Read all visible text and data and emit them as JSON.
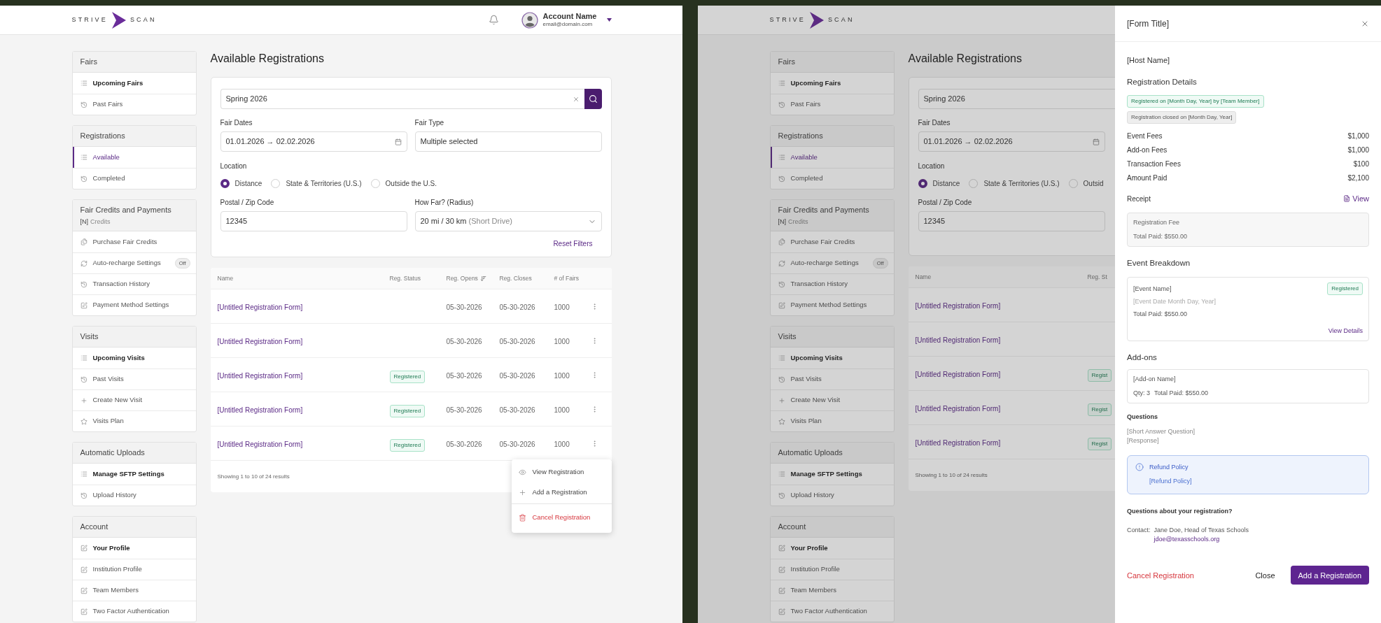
{
  "screens": [
    {
      "header": {
        "logo": {
          "left": "STRIVE",
          "right": "SCAN"
        },
        "account": {
          "name": "Account Name",
          "email": "email@domain.com"
        }
      },
      "sidebar": [
        {
          "title": "Fairs",
          "items": [
            {
              "label": "Upcoming Fairs",
              "kind": "list",
              "selected": false,
              "bold": true
            },
            {
              "label": "Past Fairs",
              "kind": "history",
              "selected": false,
              "bold": false
            }
          ]
        },
        {
          "title": "Registrations",
          "items": [
            {
              "label": "Available",
              "kind": "list",
              "selected": true
            },
            {
              "label": "Completed",
              "kind": "history",
              "selected": false,
              "bold": false
            }
          ]
        },
        {
          "title": "Fair Credits and Payments",
          "count": "[N]",
          "count_label": "Credits",
          "items": [
            {
              "label": "Purchase Fair Credits",
              "kind": "credits",
              "selected": false,
              "bold": false
            },
            {
              "label": "Auto-recharge Settings",
              "kind": "recharge",
              "selected": false,
              "bold": false,
              "badge": "Off"
            },
            {
              "label": "Transaction History",
              "kind": "history",
              "selected": false,
              "bold": false
            },
            {
              "label": "Payment Method Settings",
              "kind": "edit",
              "selected": false,
              "bold": false
            }
          ]
        },
        {
          "title": "Visits",
          "items": [
            {
              "label": "Upcoming Visits",
              "kind": "list",
              "selected": false,
              "bold": true
            },
            {
              "label": "Past Visits",
              "kind": "history",
              "selected": false,
              "bold": false
            },
            {
              "label": "Create New Visit",
              "kind": "plus",
              "selected": false,
              "bold": false
            },
            {
              "label": "Visits Plan",
              "kind": "star",
              "selected": false,
              "bold": false
            }
          ]
        },
        {
          "title": "Automatic Uploads",
          "items": [
            {
              "label": "Manage SFTP Settings",
              "kind": "list",
              "selected": false,
              "bold": true
            },
            {
              "label": "Upload History",
              "kind": "history",
              "selected": false,
              "bold": false
            }
          ]
        },
        {
          "title": "Account",
          "items": [
            {
              "label": "Your Profile",
              "kind": "edit",
              "selected": false,
              "bold": true
            },
            {
              "label": "Institution Profile",
              "kind": "edit",
              "selected": false,
              "bold": false
            },
            {
              "label": "Team Members",
              "kind": "edit",
              "selected": false,
              "bold": false
            },
            {
              "label": "Two Factor Authentication",
              "kind": "edit",
              "selected": false,
              "bold": false
            }
          ]
        }
      ],
      "main": {
        "title": "Available Registrations",
        "filters": {
          "search": {
            "value": "Spring 2026",
            "clear_button": true,
            "search_button": true
          },
          "fair_dates": {
            "label": "Fair Dates",
            "start": "01.01.2026",
            "separator": "→",
            "end": "02.02.2026"
          },
          "fair_type": {
            "label": "Fair Type",
            "value": "Multiple selected"
          },
          "location": {
            "label": "Location",
            "options": [
              {
                "label": "Distance",
                "selected": true
              },
              {
                "label": "State & Territories (U.S.)",
                "selected": false
              },
              {
                "label": "Outside the U.S.",
                "selected": false
              }
            ]
          },
          "postal": {
            "label": "Postal / Zip Code",
            "value": "12345"
          },
          "radius": {
            "label": "How Far? (Radius)",
            "value": "20 mi / 30 km",
            "hint": "(Short Drive)"
          },
          "reset": "Reset Filters"
        },
        "table": {
          "columns": [
            {
              "label": "Name",
              "sorted": false
            },
            {
              "label": "Reg. Status",
              "sorted": false
            },
            {
              "label": "Reg. Opens",
              "sorted": true
            },
            {
              "label": "Reg. Closes",
              "sorted": false
            },
            {
              "label": "# of Fairs",
              "sorted": false
            }
          ],
          "row_actions": true,
          "rows": [
            {
              "name": "[Untitled Registration Form]",
              "opens": "05-30-2026",
              "closes": "05-30-2026",
              "fairs": "1000"
            },
            {
              "name": "[Untitled Registration Form]",
              "opens": "05-30-2026",
              "closes": "05-30-2026",
              "fairs": "1000"
            },
            {
              "name": "[Untitled Registration Form]",
              "status": "Registered",
              "opens": "05-30-2026",
              "closes": "05-30-2026",
              "fairs": "1000"
            },
            {
              "name": "[Untitled Registration Form]",
              "status": "Registered",
              "opens": "05-30-2026",
              "closes": "05-30-2026",
              "fairs": "1000"
            },
            {
              "name": "[Untitled Registration Form]",
              "status": "Registered",
              "opens": "05-30-2026",
              "closes": "05-30-2026",
              "fairs": "1000"
            }
          ],
          "footer": "Showing 1 to 10 of 24 results",
          "menu": [
            {
              "label": "View Registration",
              "kind": "view"
            },
            {
              "label": "Add a Registration",
              "kind": "add"
            },
            {
              "label": "Cancel Registration",
              "kind": "danger"
            }
          ]
        }
      }
    },
    {
      "dimmed": true,
      "header": {
        "logo": {
          "left": "STRIVE",
          "right": "SCAN"
        }
      },
      "sidebar": [
        {
          "title": "Fairs",
          "items": [
            {
              "label": "Upcoming Fairs",
              "kind": "list",
              "selected": false,
              "bold": true
            },
            {
              "label": "Past Fairs",
              "kind": "history",
              "selected": false,
              "bold": false
            }
          ]
        },
        {
          "title": "Registrations",
          "items": [
            {
              "label": "Available",
              "kind": "list",
              "selected": true
            },
            {
              "label": "Completed",
              "kind": "history",
              "selected": false,
              "bold": false
            }
          ]
        },
        {
          "title": "Fair Credits and Payments",
          "count": "[N]",
          "count_label": "Credits",
          "items": [
            {
              "label": "Purchase Fair Credits",
              "kind": "credits",
              "selected": false,
              "bold": false
            },
            {
              "label": "Auto-recharge Settings",
              "kind": "recharge",
              "selected": false,
              "bold": false,
              "badge": "Off"
            },
            {
              "label": "Transaction History",
              "kind": "history",
              "selected": false,
              "bold": false
            },
            {
              "label": "Payment Method Settings",
              "kind": "edit",
              "selected": false,
              "bold": false
            }
          ]
        },
        {
          "title": "Visits",
          "items": [
            {
              "label": "Upcoming Visits",
              "kind": "list",
              "selected": false,
              "bold": true
            },
            {
              "label": "Past Visits",
              "kind": "history",
              "selected": false,
              "bold": false
            },
            {
              "label": "Create New Visit",
              "kind": "plus",
              "selected": false,
              "bold": false
            },
            {
              "label": "Visits Plan",
              "kind": "star",
              "selected": false,
              "bold": false
            }
          ]
        },
        {
          "title": "Automatic Uploads",
          "items": [
            {
              "label": "Manage SFTP Settings",
              "kind": "list",
              "selected": false,
              "bold": true
            },
            {
              "label": "Upload History",
              "kind": "history",
              "selected": false,
              "bold": false
            }
          ]
        },
        {
          "title": "Account",
          "items": [
            {
              "label": "Your Profile",
              "kind": "edit",
              "selected": false,
              "bold": true
            },
            {
              "label": "Institution Profile",
              "kind": "edit",
              "selected": false,
              "bold": false
            },
            {
              "label": "Team Members",
              "kind": "edit",
              "selected": false,
              "bold": false
            },
            {
              "label": "Two Factor Authentication",
              "kind": "edit",
              "selected": false,
              "bold": false
            }
          ]
        }
      ],
      "main": {
        "title": "Available Registrations",
        "filters": {
          "search": {
            "value": "Spring 2026",
            "clear_button": false,
            "search_button": false
          },
          "fair_dates": {
            "label": "Fair Dates",
            "start": "01.01.2026",
            "separator": "→",
            "end": "02.02.2026"
          },
          "location": {
            "label": "Location",
            "options": [
              {
                "label": "Distance",
                "selected": true
              },
              {
                "label": "State & Territories (U.S.)",
                "selected": false
              },
              {
                "label": "Outsid",
                "selected": false
              }
            ]
          },
          "postal": {
            "label": "Postal / Zip Code",
            "value": "12345"
          }
        },
        "table": {
          "columns": [
            {
              "label": "Name",
              "sorted": false
            },
            {
              "label": "Reg. St",
              "sorted": false
            }
          ],
          "row_actions": false,
          "rows": [
            {
              "name": "[Untitled Registration Form]"
            },
            {
              "name": "[Untitled Registration Form]"
            },
            {
              "name": "[Untitled Registration Form]",
              "status": "Regist"
            },
            {
              "name": "[Untitled Registration Form]",
              "status": "Regist"
            },
            {
              "name": "[Untitled Registration Form]",
              "status": "Regist"
            }
          ],
          "footer": "Showing 1 to 10 of 24 results"
        }
      },
      "drawer": {
        "title": "[Form Title]",
        "host": "[Host Name]",
        "details_heading": "Registration Details",
        "badges": [
          {
            "text": "Registered on [Month Day, Year] by [Team Member]",
            "kind": "success"
          },
          {
            "text": "Registration closed on [Month Day, Year]",
            "kind": "neutral"
          }
        ],
        "fees": [
          {
            "label": "Event Fees",
            "value": "$1,000"
          },
          {
            "label": "Add-on Fees",
            "value": "$1,000"
          },
          {
            "label": "Transaction Fees",
            "value": "$100"
          },
          {
            "label": "Amount Paid",
            "value": "$2,100"
          }
        ],
        "receipt": {
          "label": "Receipt",
          "link": "View"
        },
        "fee_box": {
          "title": "Registration Fee",
          "total": "Total Paid: $550.00"
        },
        "breakdown": {
          "heading": "Event Breakdown",
          "name": "[Event Name]",
          "date": "[Event Date Month Day, Year]",
          "total": "Total Paid: $550.00",
          "status": "Registered",
          "link": "View Details"
        },
        "addons": {
          "heading": "Add-ons",
          "items": [
            {
              "name": "[Add-on Name]",
              "qty": "Qty: 3",
              "total": "Total Paid: $550.00"
            }
          ]
        },
        "questions": {
          "heading": "Questions",
          "items": [
            {
              "question": "[Short Answer Question]",
              "response": "[Response]"
            }
          ]
        },
        "refund": {
          "title": "Refund Policy",
          "text": "[Refund Policy]"
        },
        "contact": {
          "heading": "Questions about your registration?",
          "label": "Contact:",
          "name": "Jane Doe, Head of Texas Schools",
          "email": "jdoe@texasschools.org"
        },
        "actions": {
          "cancel": "Cancel Registration",
          "close": "Close",
          "primary": "Add a Registration"
        }
      }
    }
  ]
}
